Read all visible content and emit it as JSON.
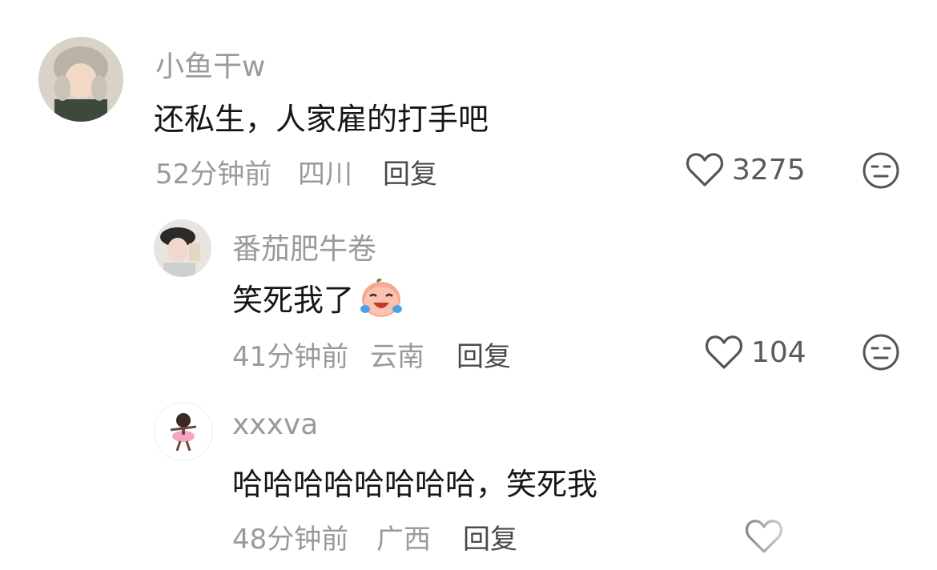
{
  "comments": [
    {
      "username": "小鱼干w",
      "text": "还私生，人家雇的打手吧",
      "time": "52分钟前",
      "location": "四川",
      "reply_label": "回复",
      "likes": "3275",
      "avatar_icon": "user-avatar-fur-hat"
    },
    {
      "username": "番茄肥牛卷",
      "text": "笑死我了",
      "emoji_icon": "crying-laughing-peach-emoji",
      "time": "41分钟前",
      "location": "云南",
      "reply_label": "回复",
      "likes": "104",
      "avatar_icon": "user-avatar-cap-girl"
    },
    {
      "username": "xxxva",
      "text": "哈哈哈哈哈哈哈哈，笑死我",
      "time": "48分钟前",
      "location": "广西",
      "reply_label": "回复",
      "avatar_icon": "user-avatar-cartoon-dancer"
    }
  ],
  "colors": {
    "username": "#9a9a9a",
    "text": "#161616",
    "meta": "#9a9a9a",
    "icon": "#555555"
  }
}
